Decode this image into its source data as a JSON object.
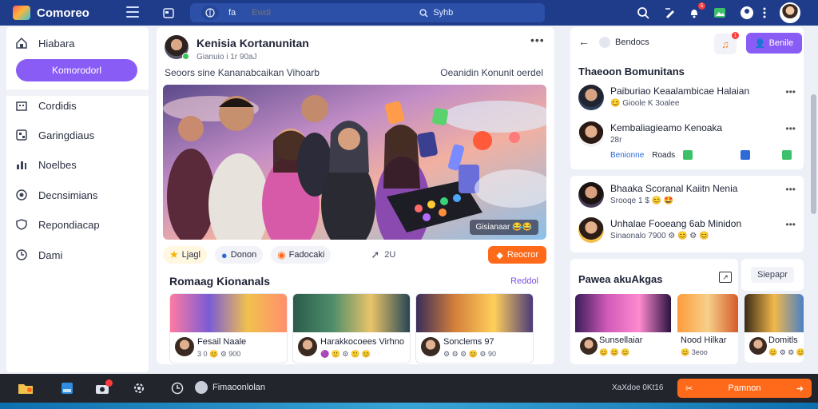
{
  "app": {
    "name": "Comoreo"
  },
  "topbar": {
    "language": "fa",
    "search_placeholder": "Ewdi",
    "search_label": "Syhb",
    "notification_count": "5"
  },
  "sidebar": {
    "items": [
      {
        "label": "Hiabara",
        "icon": "home-icon"
      },
      {
        "label": "Komorodorl",
        "icon": "",
        "active": true
      },
      {
        "label": "Cordidis",
        "icon": "building-icon"
      },
      {
        "label": "Garingdiaus",
        "icon": "grid-icon"
      },
      {
        "label": "Noelbes",
        "icon": "chart-icon"
      },
      {
        "label": "Decnsimians",
        "icon": "settings-icon"
      },
      {
        "label": "Repondiacap",
        "icon": "shield-icon"
      },
      {
        "label": "Dami",
        "icon": "clock-icon"
      }
    ]
  },
  "post": {
    "author": "Kenisia Kortanunitan",
    "meta": "Gianuio i 1r 90aJ",
    "caption_left": "Seoors sine Kananabcaikan Vihoarb",
    "caption_right": "Oeanidin Konunit oerdel",
    "image_caption": "Gisianaar 😂😂",
    "actions": {
      "like": "Ljagl",
      "comment": "Donon",
      "save": "Fadocaki",
      "share_count": "2U",
      "cta": "Reocror"
    }
  },
  "recommendations": {
    "title": "Romaag Kionanals",
    "link": "Reddol",
    "cards": [
      {
        "name": "Fesail Naale",
        "meta": "3 0 😊 ⚙ 900"
      },
      {
        "name": "Harakkocoees Virhno",
        "meta": "🟣 🙂 ⚙ 🙂 😊"
      },
      {
        "name": "Sonclems 97",
        "meta": "⚙ ⚙ ⚙ 😊 ⚙ 90"
      }
    ]
  },
  "right_panel": {
    "tab_label": "Bendocs",
    "follow_label": "Benile",
    "music_badge": "1",
    "communities_title": "Thaeoon Bomunitans",
    "people": [
      {
        "name": "Paiburiao Keaalambicae Halaian",
        "meta": "😊 Gioole K 3oalee"
      },
      {
        "name": "Kembaliagieamo Kenoaka",
        "meta": "28r"
      },
      {
        "name": "Bhaaka Scoranal Kaiitn Nenia",
        "meta": "Srooqe 1 $ 😊 🤩"
      },
      {
        "name": "Unhalae Fooeang 6ab Minidon",
        "meta": "Sinaonalo 7900 ⚙ 😊 ⚙ 😊"
      }
    ],
    "comm_actions": {
      "primary": "Benionne",
      "secondary": "Roads"
    },
    "trending_title": "Pawea akuAkgas",
    "search_button": "Siepapr",
    "trending_cards": [
      {
        "name": "Sunsellaiar",
        "meta": "😊 😊 😊"
      },
      {
        "name": "Nood Hilkar",
        "meta": "😊 3eoo"
      },
      {
        "name": "Domitls",
        "meta": "😊 ⚙ ⚙ 😊"
      }
    ]
  },
  "taskbar": {
    "app_label": "Fimaoonlolan",
    "time": "XaXdoe 0Kt16",
    "cta_label": "Pamnon"
  }
}
